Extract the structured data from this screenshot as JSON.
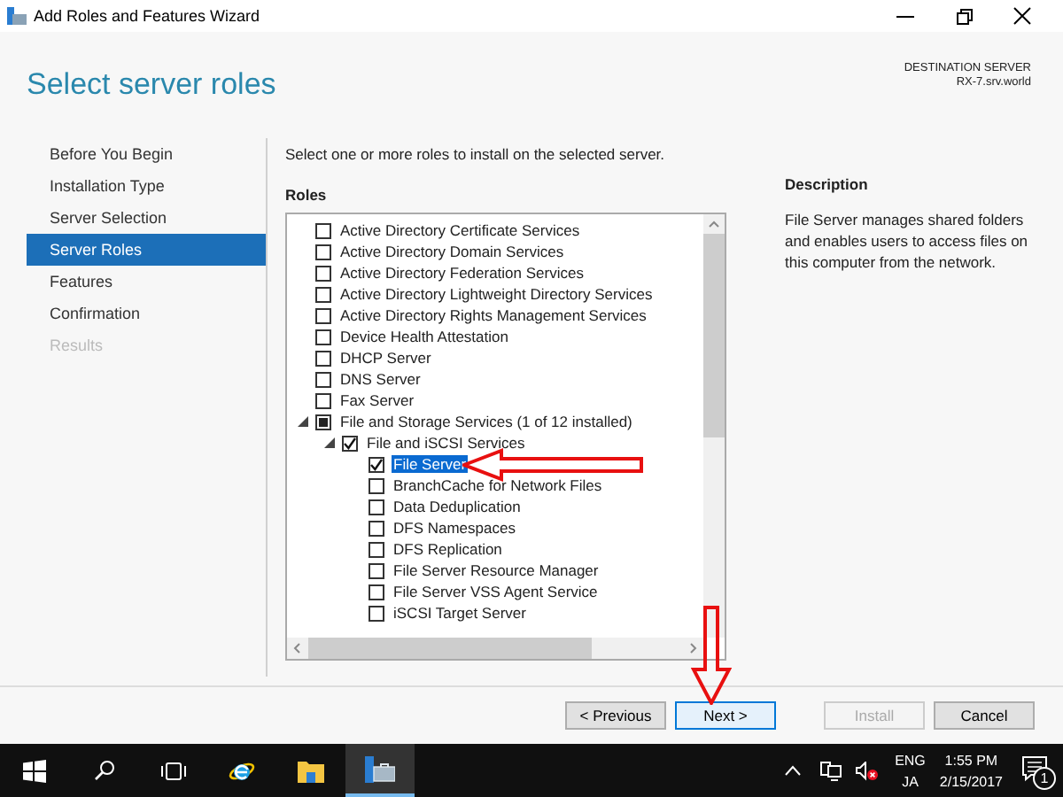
{
  "window": {
    "title": "Add Roles and Features Wizard"
  },
  "header": {
    "title": "Select server roles",
    "destination_label": "DESTINATION SERVER",
    "destination_server": "RX-7.srv.world"
  },
  "sidebar": {
    "items": [
      {
        "label": "Before You Begin",
        "selected": false,
        "disabled": false
      },
      {
        "label": "Installation Type",
        "selected": false,
        "disabled": false
      },
      {
        "label": "Server Selection",
        "selected": false,
        "disabled": false
      },
      {
        "label": "Server Roles",
        "selected": true,
        "disabled": false
      },
      {
        "label": "Features",
        "selected": false,
        "disabled": false
      },
      {
        "label": "Confirmation",
        "selected": false,
        "disabled": false
      },
      {
        "label": "Results",
        "selected": false,
        "disabled": true
      }
    ]
  },
  "instruction": "Select one or more roles to install on the selected server.",
  "roles": {
    "label": "Roles",
    "items": [
      {
        "label": "Active Directory Certificate Services",
        "checked": false,
        "indeterminate": false,
        "selected": false
      },
      {
        "label": "Active Directory Domain Services",
        "checked": false,
        "indeterminate": false,
        "selected": false
      },
      {
        "label": "Active Directory Federation Services",
        "checked": false,
        "indeterminate": false,
        "selected": false
      },
      {
        "label": "Active Directory Lightweight Directory Services",
        "checked": false,
        "indeterminate": false,
        "selected": false
      },
      {
        "label": "Active Directory Rights Management Services",
        "checked": false,
        "indeterminate": false,
        "selected": false
      },
      {
        "label": "Device Health Attestation",
        "checked": false,
        "indeterminate": false,
        "selected": false
      },
      {
        "label": "DHCP Server",
        "checked": false,
        "indeterminate": false,
        "selected": false
      },
      {
        "label": "DNS Server",
        "checked": false,
        "indeterminate": false,
        "selected": false
      },
      {
        "label": "Fax Server",
        "checked": false,
        "indeterminate": false,
        "selected": false
      },
      {
        "label": "File and Storage Services (1 of 12 installed)",
        "checked": false,
        "indeterminate": true,
        "selected": false,
        "expanded": true,
        "children": [
          {
            "label": "File and iSCSI Services",
            "checked": true,
            "indeterminate": false,
            "selected": false,
            "expanded": true,
            "children": [
              {
                "label": "File Server",
                "checked": true,
                "indeterminate": false,
                "selected": true
              },
              {
                "label": "BranchCache for Network Files",
                "checked": false,
                "indeterminate": false,
                "selected": false
              },
              {
                "label": "Data Deduplication",
                "checked": false,
                "indeterminate": false,
                "selected": false
              },
              {
                "label": "DFS Namespaces",
                "checked": false,
                "indeterminate": false,
                "selected": false
              },
              {
                "label": "DFS Replication",
                "checked": false,
                "indeterminate": false,
                "selected": false
              },
              {
                "label": "File Server Resource Manager",
                "checked": false,
                "indeterminate": false,
                "selected": false
              },
              {
                "label": "File Server VSS Agent Service",
                "checked": false,
                "indeterminate": false,
                "selected": false
              },
              {
                "label": "iSCSI Target Server",
                "checked": false,
                "indeterminate": false,
                "selected": false
              }
            ]
          }
        ]
      }
    ]
  },
  "description": {
    "heading": "Description",
    "text": "File Server manages shared folders and enables users to access files on this computer from the network."
  },
  "buttons": [
    {
      "label": "< Previous",
      "default": false,
      "disabled": false
    },
    {
      "label": "Next >",
      "default": true,
      "disabled": false
    },
    {
      "label": "Install",
      "default": false,
      "disabled": true
    },
    {
      "label": "Cancel",
      "default": false,
      "disabled": false
    }
  ],
  "taskbar": {
    "language": "ENG",
    "input_method": "JA",
    "time": "1:55 PM",
    "date": "2/15/2017",
    "notification_count": "1"
  }
}
